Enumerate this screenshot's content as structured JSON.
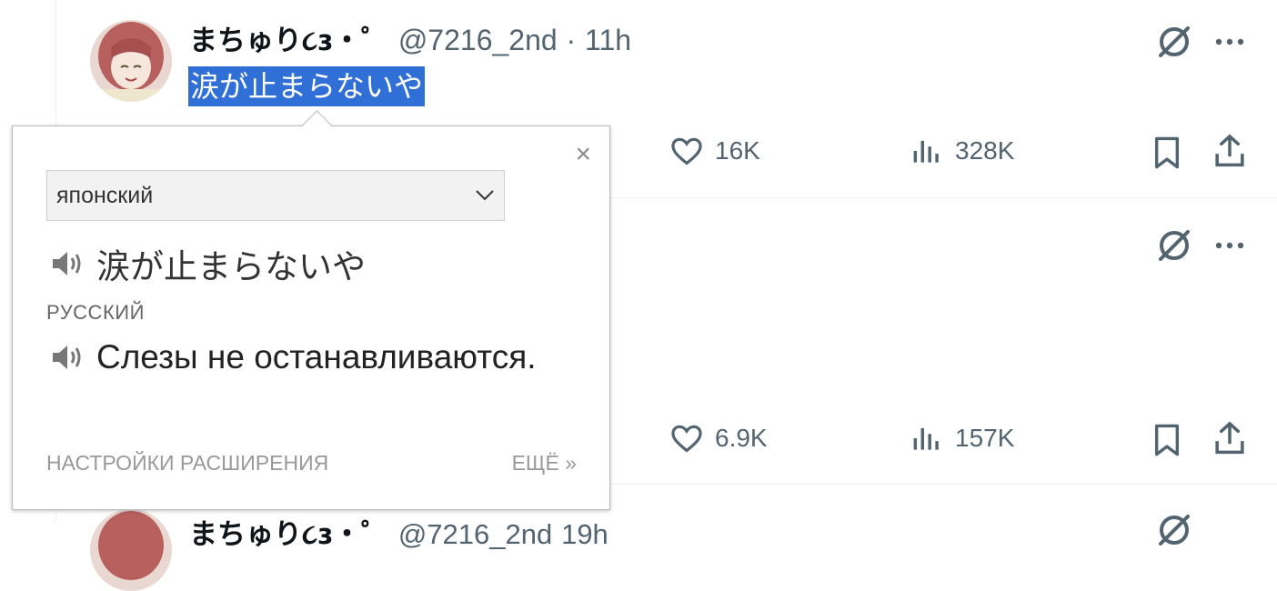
{
  "tweet1": {
    "name": "まちゅり૮ɜ・゜",
    "handle": "@7216_2nd",
    "separator": "·",
    "time": "11h",
    "text": "涙が止まらないや",
    "likes": "16K",
    "views": "328K"
  },
  "tweet2": {
    "likes": "6.9K",
    "views": "157K"
  },
  "tweet3_partial": {
    "name": "まちゅり૮ɜ・゜",
    "handle": "@7216_2nd",
    "time": "19h"
  },
  "translate_popup": {
    "close_label": "×",
    "source_language": "японский",
    "source_text": "涙が止まらないや",
    "target_language": "РУССКИЙ",
    "translation": "Слезы не останавливаются.",
    "settings_link": "НАСТРОЙКИ РАСШИРЕНИЯ",
    "more_link": "ЕЩЁ »"
  },
  "colors": {
    "selection": "#2f6fd6",
    "secondary_text": "#536471",
    "border": "#eff3f4"
  },
  "icons": [
    "grok-icon",
    "more-icon",
    "like-icon",
    "views-icon",
    "bookmark-icon",
    "share-icon",
    "speaker-icon",
    "chevron-down-icon",
    "close-icon"
  ]
}
